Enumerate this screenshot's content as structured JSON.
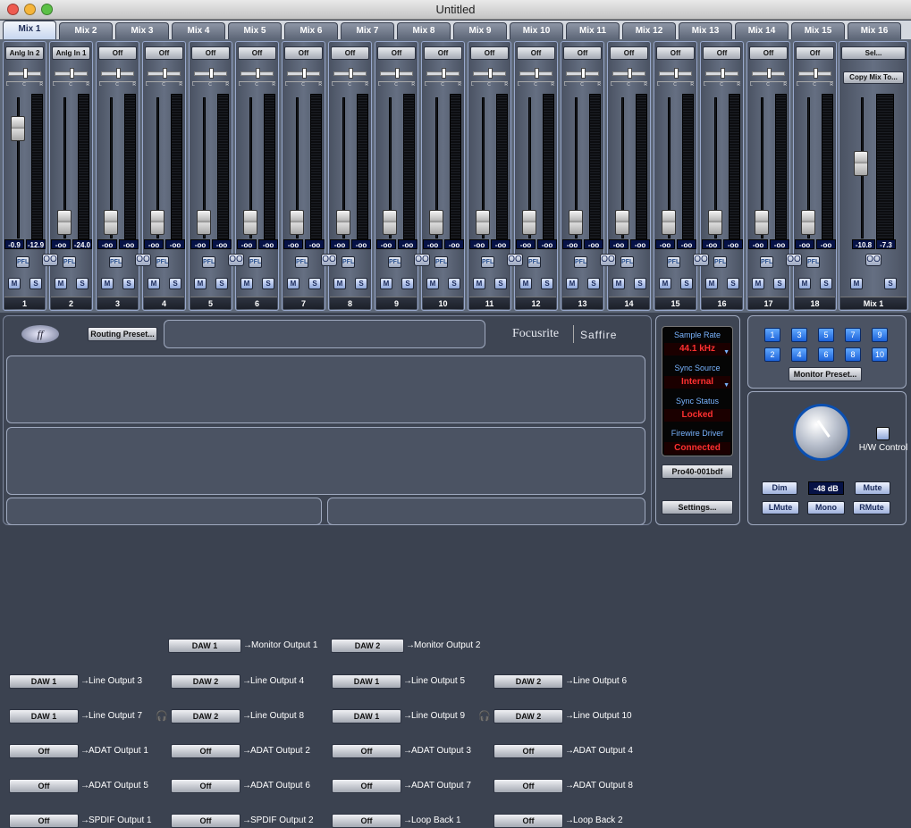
{
  "window": {
    "title": "Untitled"
  },
  "tabs": [
    "Mix 1",
    "Mix 2",
    "Mix 3",
    "Mix 4",
    "Mix 5",
    "Mix 6",
    "Mix 7",
    "Mix 8",
    "Mix 9",
    "Mix 10",
    "Mix 11",
    "Mix 12",
    "Mix 13",
    "Mix 14",
    "Mix 15",
    "Mix 16"
  ],
  "strips": [
    {
      "num": "1",
      "source": "Anlg In 2",
      "vals": [
        "-0.9",
        "-12.9"
      ],
      "fader_level": 0.78
    },
    {
      "num": "2",
      "source": "Anlg In 1",
      "vals": [
        "-oo",
        "-24.0"
      ],
      "fader_level": 0.08
    },
    {
      "num": "3",
      "source": "Off",
      "vals": [
        "-oo",
        "-oo"
      ],
      "fader_level": 0.08
    },
    {
      "num": "4",
      "source": "Off",
      "vals": [
        "-oo",
        "-oo"
      ],
      "fader_level": 0.08
    },
    {
      "num": "5",
      "source": "Off",
      "vals": [
        "-oo",
        "-oo"
      ],
      "fader_level": 0.08
    },
    {
      "num": "6",
      "source": "Off",
      "vals": [
        "-oo",
        "-oo"
      ],
      "fader_level": 0.08
    },
    {
      "num": "7",
      "source": "Off",
      "vals": [
        "-oo",
        "-oo"
      ],
      "fader_level": 0.08
    },
    {
      "num": "8",
      "source": "Off",
      "vals": [
        "-oo",
        "-oo"
      ],
      "fader_level": 0.08
    },
    {
      "num": "9",
      "source": "Off",
      "vals": [
        "-oo",
        "-oo"
      ],
      "fader_level": 0.08
    },
    {
      "num": "10",
      "source": "Off",
      "vals": [
        "-oo",
        "-oo"
      ],
      "fader_level": 0.08
    },
    {
      "num": "11",
      "source": "Off",
      "vals": [
        "-oo",
        "-oo"
      ],
      "fader_level": 0.08
    },
    {
      "num": "12",
      "source": "Off",
      "vals": [
        "-oo",
        "-oo"
      ],
      "fader_level": 0.08
    },
    {
      "num": "13",
      "source": "Off",
      "vals": [
        "-oo",
        "-oo"
      ],
      "fader_level": 0.08
    },
    {
      "num": "14",
      "source": "Off",
      "vals": [
        "-oo",
        "-oo"
      ],
      "fader_level": 0.08
    },
    {
      "num": "15",
      "source": "Off",
      "vals": [
        "-oo",
        "-oo"
      ],
      "fader_level": 0.08
    },
    {
      "num": "16",
      "source": "Off",
      "vals": [
        "-oo",
        "-oo"
      ],
      "fader_level": 0.08
    },
    {
      "num": "17",
      "source": "Off",
      "vals": [
        "-oo",
        "-oo"
      ],
      "fader_level": 0.08
    },
    {
      "num": "18",
      "source": "Off",
      "vals": [
        "-oo",
        "-oo"
      ],
      "fader_level": 0.08
    }
  ],
  "strip_labels": {
    "pfl": "PFL",
    "mute": "M",
    "solo": "S",
    "link": "OO",
    "pan_l": "L",
    "pan_c": "C",
    "pan_r": "R"
  },
  "master": {
    "select": "Sel...",
    "copy": "Copy Mix To...",
    "vals": [
      "-10.8",
      "-7.3"
    ],
    "num": "Mix 1",
    "fader_level": 0.52
  },
  "routing": {
    "preset": "Routing Preset...",
    "monitor": [
      {
        "src": "DAW 1",
        "label": "Monitor Output 1"
      },
      {
        "src": "DAW 2",
        "label": "Monitor Output 2"
      }
    ],
    "line": [
      {
        "src": "DAW 1",
        "label": "Line Output 3"
      },
      {
        "src": "DAW 2",
        "label": "Line Output 4"
      },
      {
        "src": "DAW 1",
        "label": "Line Output 5"
      },
      {
        "src": "DAW 2",
        "label": "Line Output 6"
      },
      {
        "src": "DAW 1",
        "label": "Line Output 7"
      },
      {
        "src": "DAW 2",
        "label": "Line Output 8"
      },
      {
        "src": "DAW 1",
        "label": "Line Output 9"
      },
      {
        "src": "DAW 2",
        "label": "Line Output 10"
      }
    ],
    "adat": [
      {
        "src": "Off",
        "label": "ADAT Output 1"
      },
      {
        "src": "Off",
        "label": "ADAT Output 2"
      },
      {
        "src": "Off",
        "label": "ADAT Output 3"
      },
      {
        "src": "Off",
        "label": "ADAT Output 4"
      },
      {
        "src": "Off",
        "label": "ADAT Output 5"
      },
      {
        "src": "Off",
        "label": "ADAT Output 6"
      },
      {
        "src": "Off",
        "label": "ADAT Output 7"
      },
      {
        "src": "Off",
        "label": "ADAT Output 8"
      }
    ],
    "spdif": [
      {
        "src": "Off",
        "label": "SPDIF Output 1"
      },
      {
        "src": "Off",
        "label": "SPDIF Output 2"
      }
    ],
    "loop": [
      {
        "src": "Off",
        "label": "Loop Back 1"
      },
      {
        "src": "Off",
        "label": "Loop Back 2"
      }
    ]
  },
  "brand": {
    "focusrite": "Focusrite",
    "saffire": "Saffire"
  },
  "status": {
    "sample_rate_label": "Sample Rate",
    "sample_rate": "44.1 kHz",
    "sync_source_label": "Sync Source",
    "sync_source": "Internal",
    "sync_status_label": "Sync Status",
    "sync_status": "Locked",
    "firewire_label": "Firewire Driver",
    "firewire": "Connected",
    "device": "Pro40-001bdf",
    "settings": "Settings..."
  },
  "monitor": {
    "buttons": [
      "1",
      "3",
      "5",
      "7",
      "9",
      "2",
      "4",
      "6",
      "8",
      "10"
    ],
    "preset": "Monitor Preset...",
    "hw_control": "H/W Control",
    "dim": "Dim",
    "level": "-48 dB",
    "mute": "Mute",
    "lmute": "LMute",
    "mono": "Mono",
    "rmute": "RMute"
  }
}
